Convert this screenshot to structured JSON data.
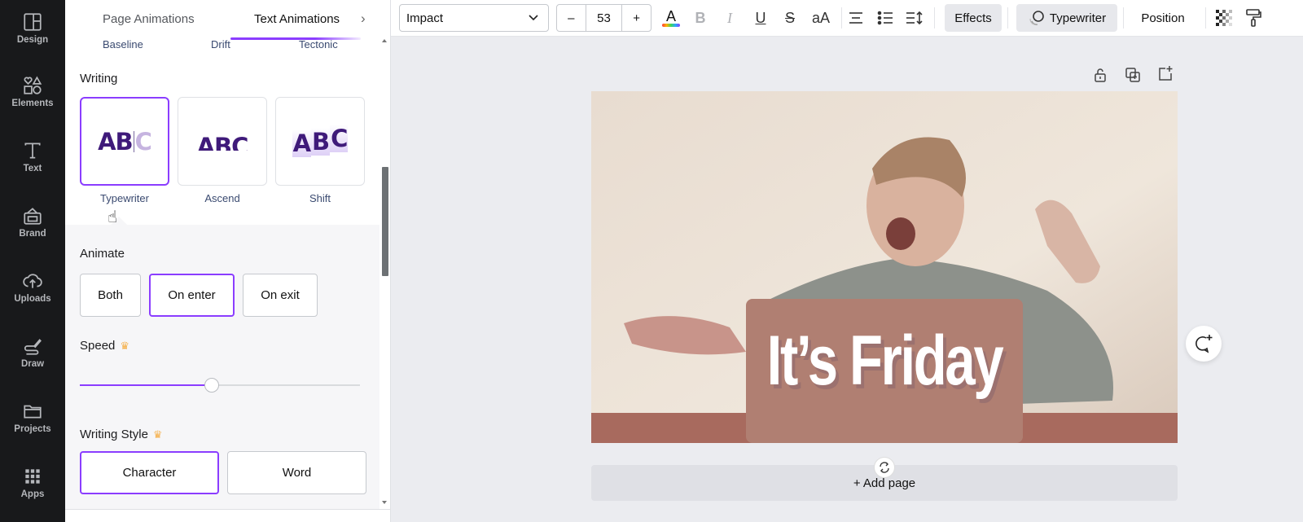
{
  "rail": {
    "items": [
      {
        "label": "Design",
        "icon": "layout-icon"
      },
      {
        "label": "Elements",
        "icon": "shapes-icon"
      },
      {
        "label": "Text",
        "icon": "text-icon"
      },
      {
        "label": "Brand",
        "icon": "brand-kit-icon"
      },
      {
        "label": "Uploads",
        "icon": "cloud-upload-icon"
      },
      {
        "label": "Draw",
        "icon": "pen-icon"
      },
      {
        "label": "Projects",
        "icon": "folder-icon"
      },
      {
        "label": "Apps",
        "icon": "grid-icon"
      }
    ]
  },
  "panel": {
    "tabs": [
      {
        "label": "Page Animations",
        "active": false
      },
      {
        "label": "Text Animations",
        "active": true
      }
    ],
    "prev_row": [
      "Baseline",
      "Drift",
      "Tectonic"
    ],
    "writing": {
      "title": "Writing",
      "cards": [
        {
          "label": "Typewriter",
          "selected": true
        },
        {
          "label": "Ascend",
          "selected": false
        },
        {
          "label": "Shift",
          "selected": false
        }
      ],
      "preview_text": "ABC"
    },
    "animate": {
      "title": "Animate",
      "options": [
        {
          "label": "Both",
          "selected": false
        },
        {
          "label": "On enter",
          "selected": true
        },
        {
          "label": "On exit",
          "selected": false
        }
      ]
    },
    "speed": {
      "title": "Speed",
      "premium": true,
      "value_percent": 47
    },
    "writing_style": {
      "title": "Writing Style",
      "premium": true,
      "options": [
        {
          "label": "Character",
          "selected": true
        },
        {
          "label": "Word",
          "selected": false
        }
      ]
    }
  },
  "toolbar": {
    "font": "Impact",
    "font_size": "53",
    "minus": "–",
    "plus": "+",
    "text_color_glyph": "A",
    "bold": "B",
    "italic": "I",
    "underline": "U",
    "strikethrough": "S",
    "case": "aA",
    "effects": "Effects",
    "animation": "Typewriter",
    "position": "Position"
  },
  "canvas": {
    "text": "It’s Friday",
    "add_page": "+ Add page"
  },
  "colors": {
    "accent": "#8b3dff",
    "rail_bg": "#18191b",
    "canvas_bg": "#ebecf0",
    "premium": "#f5b04a"
  }
}
